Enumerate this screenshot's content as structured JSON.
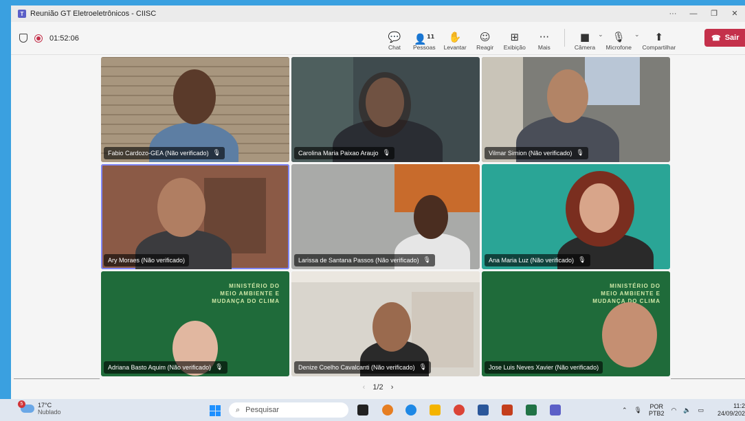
{
  "window": {
    "title": "Reunião GT Eletroeletrônicos - CIISC"
  },
  "call": {
    "duration": "01:52:06"
  },
  "toolbar": {
    "chat": "Chat",
    "people": "Pessoas",
    "people_count": "11",
    "raise": "Levantar",
    "react": "Reagir",
    "view": "Exibição",
    "more": "Mais",
    "camera": "Câmera",
    "mic": "Microfone",
    "share": "Compartilhar",
    "leave": "Sair"
  },
  "participants": [
    {
      "name": "Fabio Cardozo-GEA (Não verificado)",
      "muted": true
    },
    {
      "name": "Carolina Maria Paixao Araujo",
      "muted": true
    },
    {
      "name": "Vilmar Simion (Não verificado)",
      "muted": true
    },
    {
      "name": "Ary Moraes (Não verificado)",
      "muted": false,
      "active": true
    },
    {
      "name": "Larissa de Santana Passos (Não verificado)",
      "muted": true
    },
    {
      "name": "Ana Maria Luz (Não verificado)",
      "muted": true
    },
    {
      "name": "Adriana Basto Aquim (Não verificado)",
      "muted": true
    },
    {
      "name": "Denize Coelho Cavalcanti (Não verificado)",
      "muted": true
    },
    {
      "name": "Jose Luis Neves Xavier (Não verificado)",
      "muted": false
    }
  ],
  "backgrounds": {
    "ministry_text": "MINISTÉRIO DO\nMEIO AMBIENTE E\nMUDANÇA DO CLIMA"
  },
  "pager": {
    "label": "1/2"
  },
  "taskbar": {
    "weather_temp": "17°C",
    "weather_desc": "Nublado",
    "weather_badge": "5",
    "search_placeholder": "Pesquisar",
    "lang": "POR",
    "layout": "PTB2",
    "time": "11:2",
    "date": "24/09/202"
  },
  "colors": {
    "leave": "#c4314b",
    "accent": "#5b5fc7",
    "green_bg": "#1f6b3a"
  }
}
